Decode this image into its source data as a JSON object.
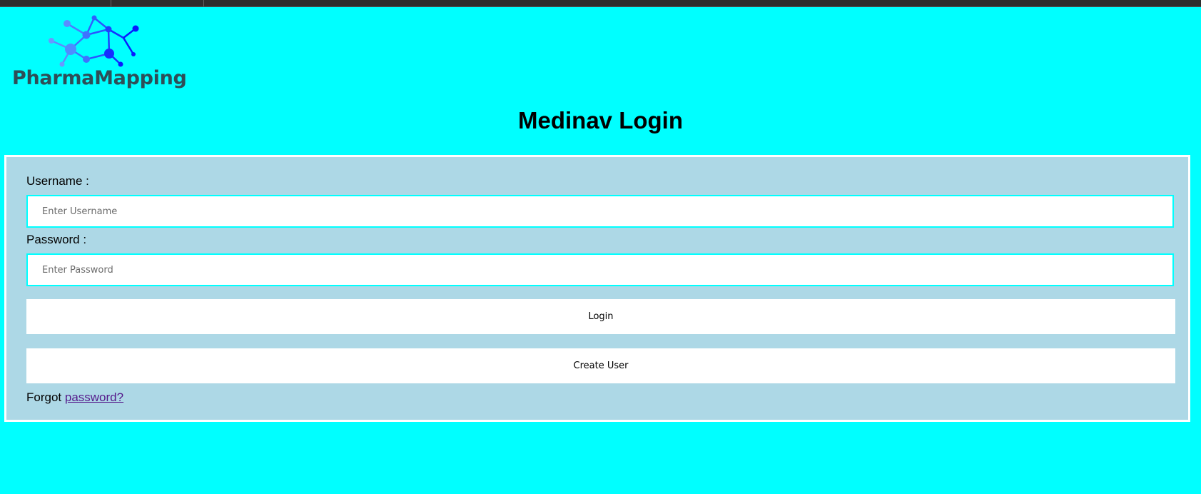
{
  "logo": {
    "text": "PharmaMapping",
    "icon": "molecule-network-icon",
    "colors": [
      "#4d8dff",
      "#2f6bff",
      "#0a1aff"
    ]
  },
  "page": {
    "title": "Medinav Login",
    "background": "#00ffff"
  },
  "form": {
    "username_label": "Username :",
    "username_placeholder": "Enter Username",
    "username_value": "",
    "password_label": "Password :",
    "password_placeholder": "Enter Password",
    "password_value": "",
    "login_label": "Login",
    "create_user_label": "Create User",
    "forgot_text": "Forgot",
    "forgot_link": "password?",
    "panel_color": "#add8e6"
  }
}
